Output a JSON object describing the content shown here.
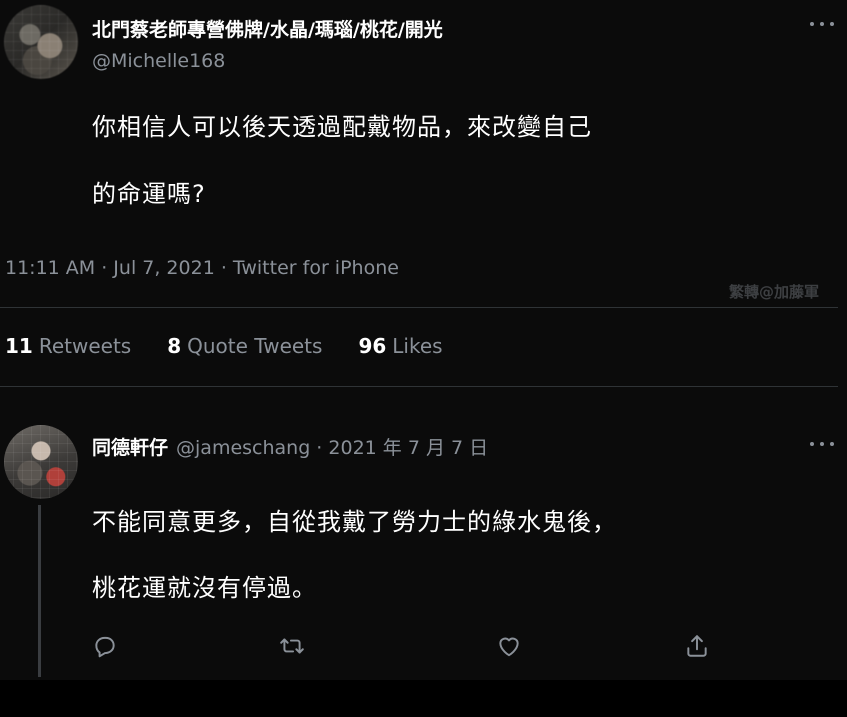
{
  "tweet": {
    "display_name": "北門蔡老師專營佛牌/水晶/瑪瑙/桃花/開光",
    "handle": "@Michelle168",
    "text_line1": "你相信人可以後天透過配戴物品，來改變自己",
    "text_line2": "的命運嗎?",
    "meta": "11:11 AM · Jul 7, 2021 · Twitter for iPhone",
    "watermark": "繁轉@加藤軍",
    "stats": [
      {
        "num": "11",
        "label": "Retweets"
      },
      {
        "num": "8",
        "label": "Quote Tweets"
      },
      {
        "num": "96",
        "label": "Likes"
      }
    ]
  },
  "reply": {
    "display_name": "同德軒仔",
    "meta": "@jameschang · 2021 年 7 月 7 日",
    "text_line1": "不能同意更多，自從我戴了勞力士的綠水鬼後，",
    "text_line2": "桃花運就沒有停過。"
  },
  "icons": {
    "more": "more-icon",
    "reply": "reply-icon",
    "retweet": "retweet-icon",
    "like": "like-icon",
    "share": "share-icon"
  },
  "colors": {
    "background": "#0b0b0b",
    "secondary_text": "#8b9199",
    "divider": "#2f3336"
  }
}
